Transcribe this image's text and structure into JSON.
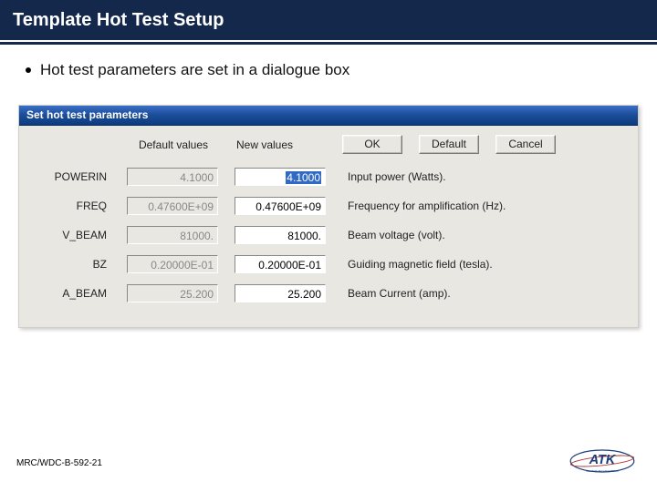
{
  "slide": {
    "title": "Template Hot Test Setup",
    "bullet": "Hot test parameters are set in a dialogue box",
    "footer_code": "MRC/WDC-B-592-21"
  },
  "dialog": {
    "title": "Set hot test parameters",
    "headers": {
      "default": "Default values",
      "new": "New values"
    },
    "buttons": {
      "ok": "OK",
      "default": "Default",
      "cancel": "Cancel"
    },
    "rows": [
      {
        "name": "POWERIN",
        "default": "4.1000",
        "new": "4.1000",
        "desc": "Input power (Watts).",
        "selected": true
      },
      {
        "name": "FREQ",
        "default": "0.47600E+09",
        "new": "0.47600E+09",
        "desc": "Frequency for amplification (Hz)."
      },
      {
        "name": "V_BEAM",
        "default": "81000.",
        "new": "81000.",
        "desc": "Beam voltage (volt)."
      },
      {
        "name": "BZ",
        "default": "0.20000E-01",
        "new": "0.20000E-01",
        "desc": "Guiding magnetic field (tesla)."
      },
      {
        "name": "A_BEAM",
        "default": "25.200",
        "new": "25.200",
        "desc": "Beam Current (amp)."
      }
    ]
  },
  "logo": {
    "text": "ATK",
    "tagline": "ALLIANT TECHSYSTEMS"
  }
}
